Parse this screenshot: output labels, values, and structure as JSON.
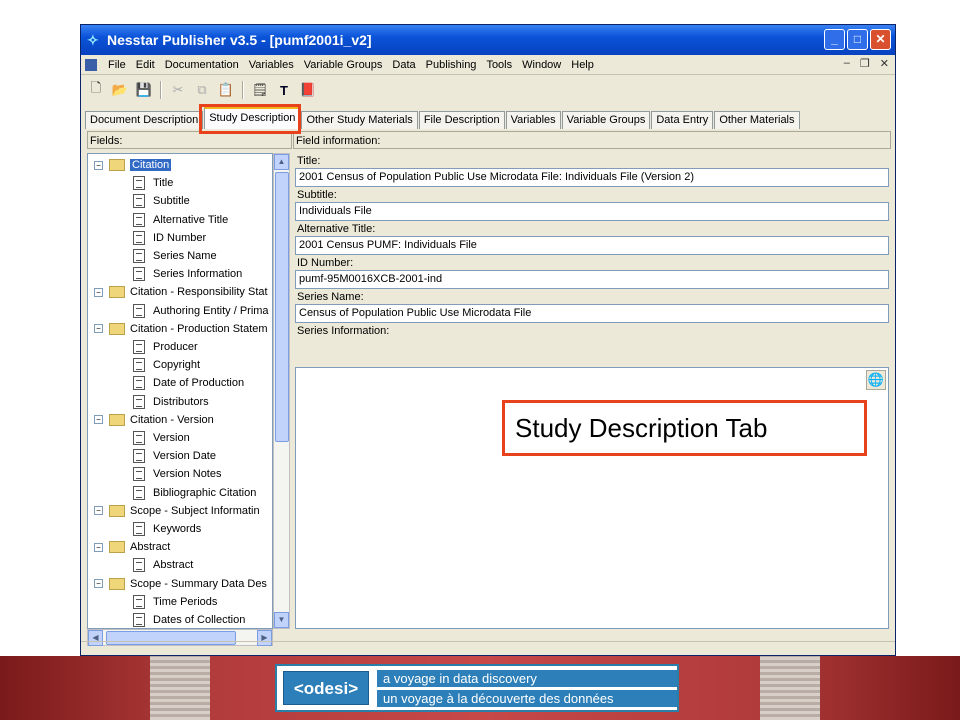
{
  "window": {
    "title": "Nesstar Publisher v3.5 - [pumf2001i_v2]"
  },
  "menu": [
    "File",
    "Edit",
    "Documentation",
    "Variables",
    "Variable Groups",
    "Data",
    "Publishing",
    "Tools",
    "Window",
    "Help"
  ],
  "tabs": [
    "Document Description",
    "Study Description",
    "Other Study Materials",
    "File Description",
    "Variables",
    "Variable Groups",
    "Data Entry",
    "Other Materials"
  ],
  "left_panel": {
    "header": "Fields:"
  },
  "tree": [
    {
      "label": "Citation",
      "level": 0,
      "type": "folder",
      "selected": true
    },
    {
      "label": "Title",
      "level": 1,
      "type": "doc",
      "req": true
    },
    {
      "label": "Subtitle",
      "level": 1,
      "type": "doc"
    },
    {
      "label": "Alternative Title",
      "level": 1,
      "type": "doc"
    },
    {
      "label": "ID Number",
      "level": 1,
      "type": "doc"
    },
    {
      "label": "Series Name",
      "level": 1,
      "type": "doc"
    },
    {
      "label": "Series Information",
      "level": 1,
      "type": "doc"
    },
    {
      "label": "Citation - Responsibility Stat",
      "level": 0,
      "type": "folder"
    },
    {
      "label": "Authoring Entity / Prima",
      "level": 1,
      "type": "doc",
      "req": true
    },
    {
      "label": "Citation - Production Statem",
      "level": 0,
      "type": "folder"
    },
    {
      "label": "Producer",
      "level": 1,
      "type": "doc",
      "req": true
    },
    {
      "label": "Copyright",
      "level": 1,
      "type": "doc"
    },
    {
      "label": "Date of Production",
      "level": 1,
      "type": "doc"
    },
    {
      "label": "Distributors",
      "level": 1,
      "type": "doc",
      "req": true
    },
    {
      "label": "Citation - Version",
      "level": 0,
      "type": "folder"
    },
    {
      "label": "Version",
      "level": 1,
      "type": "doc",
      "req": true
    },
    {
      "label": "Version Date",
      "level": 1,
      "type": "doc"
    },
    {
      "label": "Version Notes",
      "level": 1,
      "type": "doc"
    },
    {
      "label": "Bibliographic Citation",
      "level": 1,
      "type": "doc"
    },
    {
      "label": "Scope - Subject Informatin",
      "level": 0,
      "type": "folder"
    },
    {
      "label": "Keywords",
      "level": 1,
      "type": "doc",
      "req": true
    },
    {
      "label": "Abstract",
      "level": 0,
      "type": "folder"
    },
    {
      "label": "Abstract",
      "level": 1,
      "type": "doc",
      "req": true
    },
    {
      "label": "Scope - Summary Data Des",
      "level": 0,
      "type": "folder"
    },
    {
      "label": "Time Periods",
      "level": 1,
      "type": "doc",
      "req": true
    },
    {
      "label": "Dates of Collection",
      "level": 1,
      "type": "doc",
      "req": true
    }
  ],
  "right_panel": {
    "header": "Field information:"
  },
  "fields": [
    {
      "label": "Title:",
      "value": "2001 Census of Population Public Use Microdata File: Individuals File (Version 2)"
    },
    {
      "label": "Subtitle:",
      "value": "Individuals File"
    },
    {
      "label": "Alternative Title:",
      "value": "2001 Census PUMF: Individuals File"
    },
    {
      "label": "ID Number:",
      "value": "pumf-95M0016XCB-2001-ind"
    },
    {
      "label": "Series Name:",
      "value": "Census of Population Public Use Microdata File"
    }
  ],
  "series_info": {
    "label": "Series Information:",
    "value": ""
  },
  "callout": "Study Description Tab",
  "footer": {
    "logo": "<odesi>",
    "slogan_en": "a voyage in data discovery",
    "slogan_fr": "un voyage à la découverte des données"
  }
}
